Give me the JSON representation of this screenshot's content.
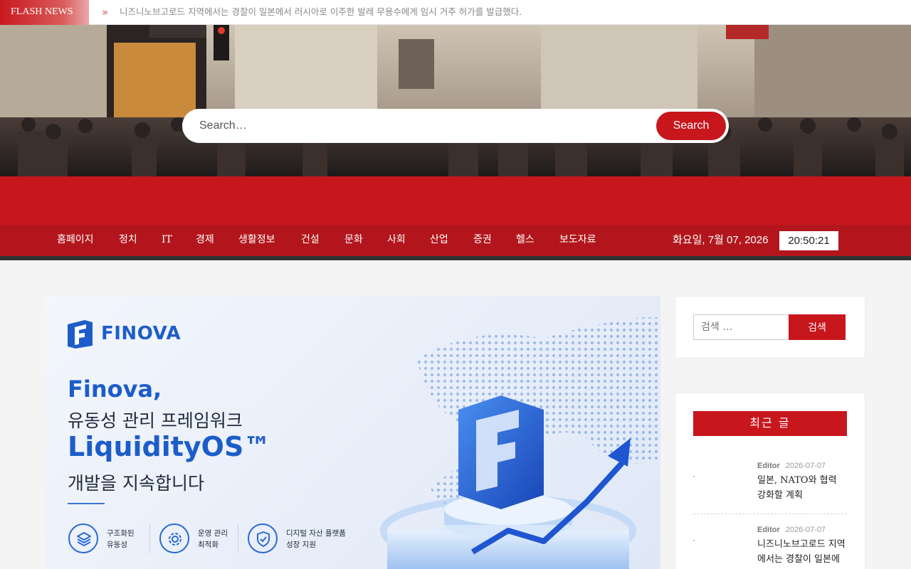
{
  "flash": {
    "label": "FLASH NEWS",
    "arrow": "»",
    "text": "니즈니노브고로드 지역에서는 경찰이 일본에서 러시아로 이주한 발레 무용수에게 임시 거주 허가를 발급했다."
  },
  "hero": {
    "search_placeholder": "Search…",
    "search_button": "Search"
  },
  "nav": {
    "items": [
      "홈페이지",
      "정치",
      "IT",
      "경제",
      "생활정보",
      "건설",
      "문화",
      "사회",
      "산업",
      "증권",
      "헬스",
      "보도자료"
    ],
    "date": "화요일, 7월 07, 2026",
    "time": "20:50:21"
  },
  "banner": {
    "brand": "FINOVA",
    "headline_1": "Finova,",
    "headline_2": "유동성 관리 프레임워크",
    "headline_3": "LiquidityOS™",
    "headline_4": "개발을 지속합니다",
    "features": [
      {
        "line1": "구조화된",
        "line2": "유동성",
        "icon": "layers-icon"
      },
      {
        "line1": "운영 관리",
        "line2": "최적화",
        "icon": "gear-icon"
      },
      {
        "line1": "디지털 자산 플랫폼",
        "line2": "성장 지원",
        "icon": "shield-check-icon"
      }
    ]
  },
  "sidebar": {
    "search_placeholder": "검색 …",
    "search_button": "검색",
    "recent_title": "최근 글",
    "posts": [
      {
        "author": "Editor",
        "date": "2026-07-07",
        "title": "일본, NATO와 협력 강화할 계획"
      },
      {
        "author": "Editor",
        "date": "2026-07-07",
        "title": "니즈니노브고로드 지역에서는 경찰이 일본에서 러시아로 이주한"
      }
    ]
  },
  "colors": {
    "brand_red": "#c8161d",
    "nav_red": "#b2161c",
    "finova_blue": "#1d5dc9"
  }
}
